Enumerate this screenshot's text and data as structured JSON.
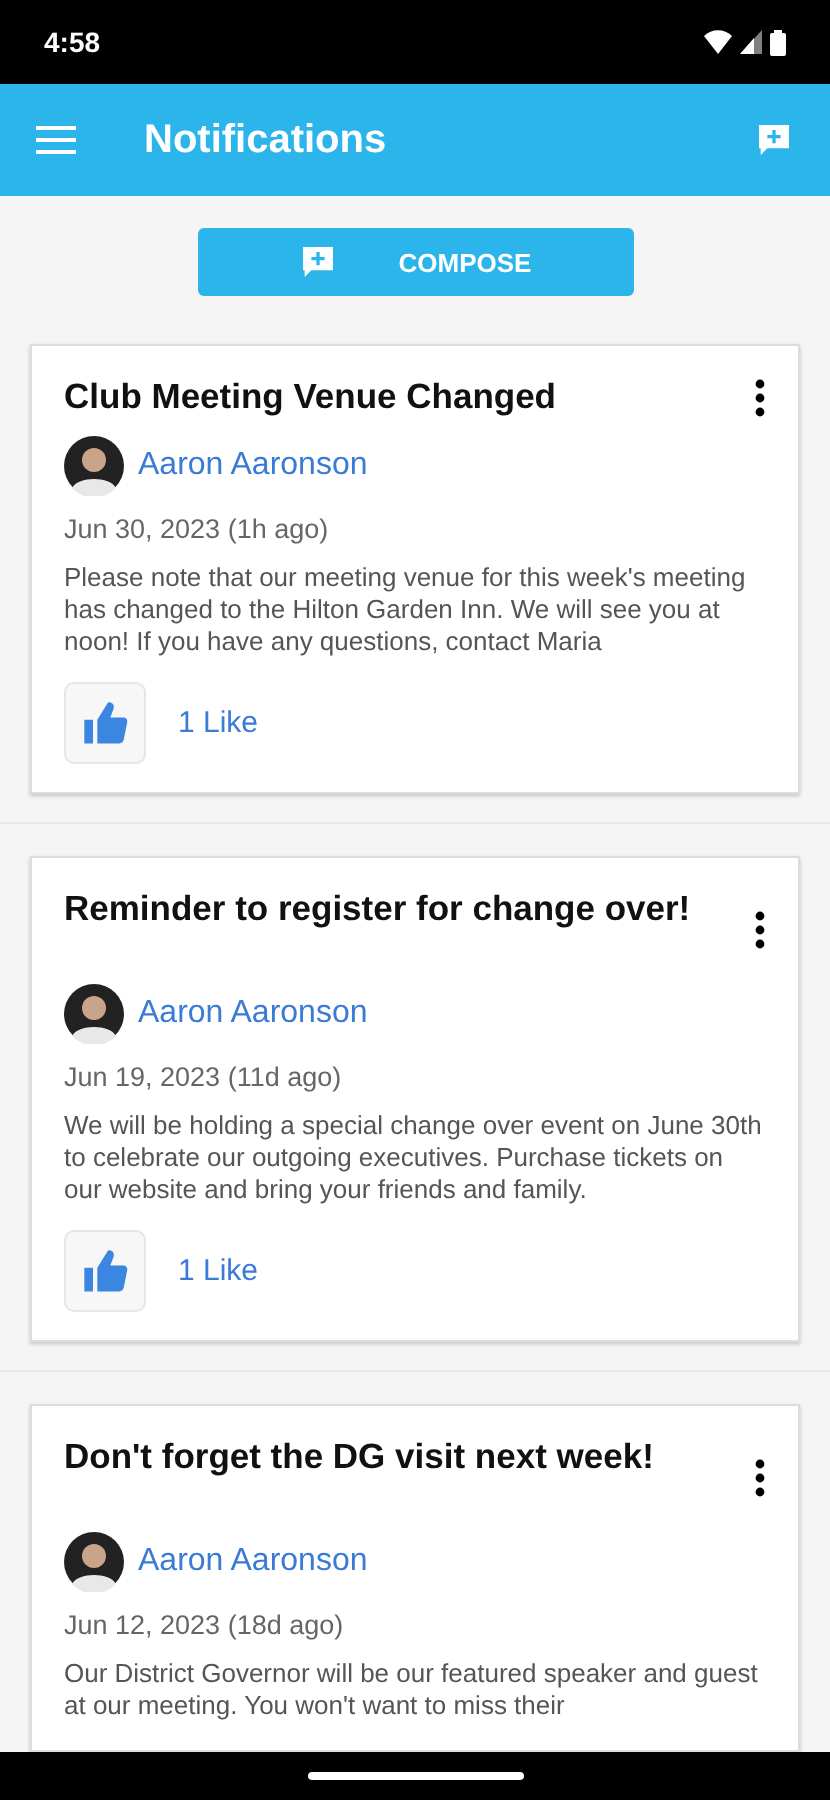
{
  "status_bar": {
    "time": "4:58"
  },
  "app_bar": {
    "title": "Notifications"
  },
  "compose_button": {
    "label": "COMPOSE"
  },
  "posts": [
    {
      "title": "Club Meeting Venue Changed",
      "author": "Aaron Aaronson",
      "date": "Jun 30, 2023 (1h ago)",
      "body": "Please note that our meeting venue for this week's meeting has changed to the Hilton Garden Inn. We will see you at noon! If you have any questions, contact Maria",
      "likes": "1 Like"
    },
    {
      "title": "Reminder to register for change over!",
      "author": "Aaron Aaronson",
      "date": "Jun 19, 2023 (11d ago)",
      "body": "We will be holding a special change over event on June 30th to celebrate our outgoing executives. Purchase tickets on our website and bring your friends and family.",
      "likes": "1 Like"
    },
    {
      "title": "Don't forget the DG visit next week!",
      "author": "Aaron Aaronson",
      "date": "Jun 12, 2023 (18d ago)",
      "body": "Our District Governor will be our featured speaker and guest at our meeting. You won't want to miss their"
    }
  ]
}
